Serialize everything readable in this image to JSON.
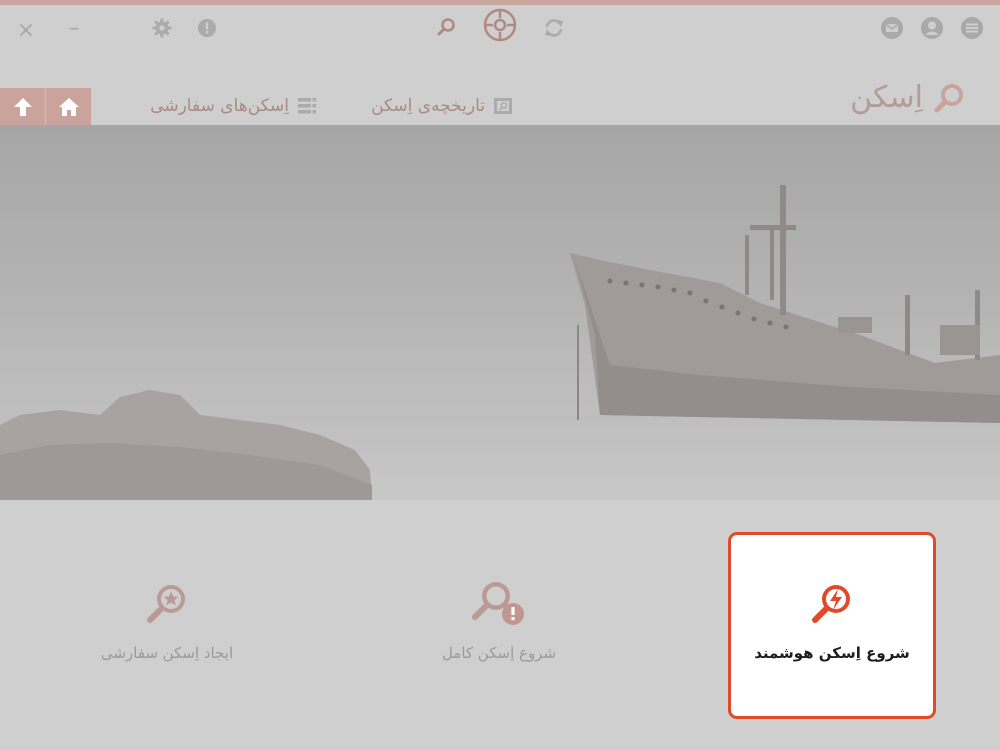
{
  "window": {
    "close_symbol": "×",
    "minimize_symbol": "–"
  },
  "icons": {
    "settings": "gear-icon",
    "alert": "exclamation-circle-icon",
    "scan_small": "magnifier-icon",
    "target": "crosshair-target-icon",
    "refresh": "refresh-icon",
    "mail": "envelope-icon",
    "user": "user-icon",
    "menu": "hamburger-menu-icon",
    "home": "home-icon",
    "up": "up-arrow-icon"
  },
  "nav": {
    "title": "اِسکن",
    "tabs": [
      {
        "label": "تاریخچه‌ی اِسکن",
        "icon": "history-document-icon"
      },
      {
        "label": "اِسکن‌های سفارشی",
        "icon": "list-icon"
      }
    ]
  },
  "cards": [
    {
      "label": "شروع اِسکن هوشمند",
      "icon": "smart-scan-bolt-icon",
      "active": true
    },
    {
      "label": "شروع اِسکن کامل",
      "icon": "full-scan-alert-icon",
      "active": false
    },
    {
      "label": "ایجاد اِسکن سفارشی",
      "icon": "custom-scan-star-icon",
      "active": false
    }
  ],
  "colors": {
    "accent": "#e04a2a",
    "muted_accent": "#c9a39c",
    "background": "#cfcfcf"
  }
}
